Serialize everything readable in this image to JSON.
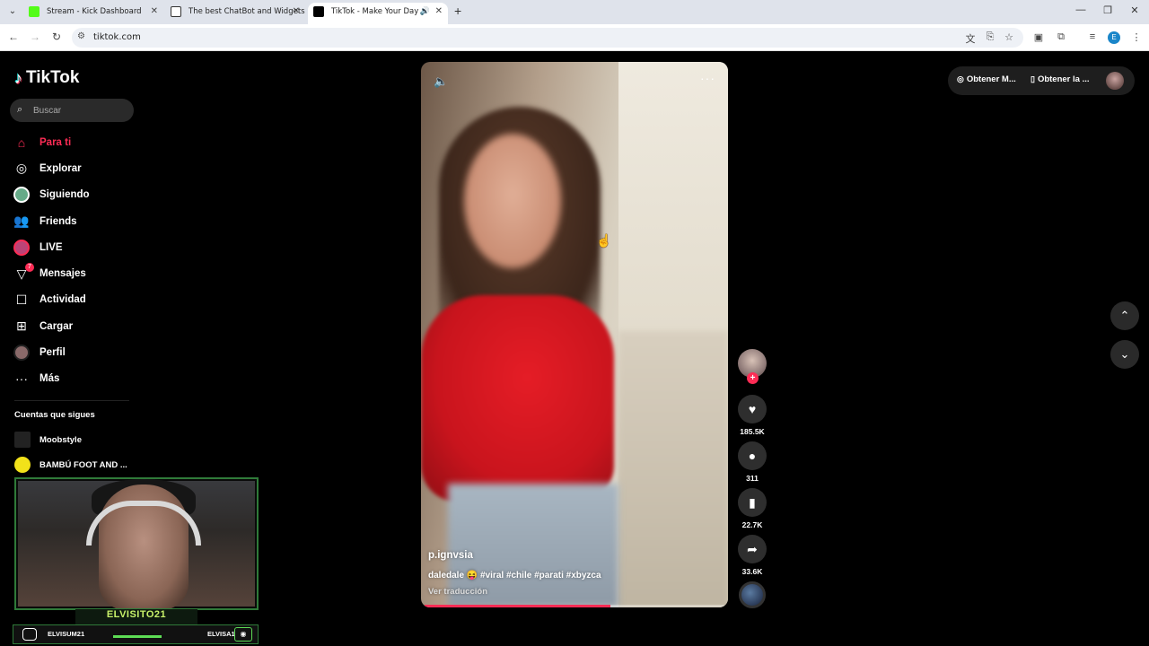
{
  "browser": {
    "tabs": [
      {
        "title": "Stream - Kick Dashboard",
        "favicon_color": "#53fc18"
      },
      {
        "title": "The best ChatBot and Widgets",
        "favicon_color": "#333333"
      },
      {
        "title": "TikTok - Make Your Day",
        "favicon_color": "#000000"
      }
    ],
    "url": "tiktok.com",
    "profile_letter": "E"
  },
  "tiktok": {
    "logo": "TikTok",
    "search_placeholder": "Buscar",
    "menu": [
      {
        "label": "Para ti",
        "icon": "home-icon"
      },
      {
        "label": "Explorar",
        "icon": "compass-icon"
      },
      {
        "label": "Siguiendo",
        "icon": "following-avatar-icon"
      },
      {
        "label": "Friends",
        "icon": "friends-icon"
      },
      {
        "label": "LIVE",
        "icon": "live-icon"
      },
      {
        "label": "Mensajes",
        "icon": "messages-icon",
        "badge": "7"
      },
      {
        "label": "Actividad",
        "icon": "activity-icon"
      },
      {
        "label": "Cargar",
        "icon": "upload-icon"
      },
      {
        "label": "Perfil",
        "icon": "profile-avatar-icon"
      },
      {
        "label": "Más",
        "icon": "more-icon"
      }
    ],
    "following_title": "Cuentas que sigues",
    "following": [
      {
        "name": "Moobstyle"
      },
      {
        "name": "BAMBÚ FOOT AND ..."
      }
    ],
    "top_right": {
      "coins": "Obtener M...",
      "app": "Obtener la ..."
    }
  },
  "video": {
    "username": "p.ignvsia",
    "description": "daledale 😝 #viral #chile #parati #xbyzca",
    "translate": "Ver traducción",
    "progress": 0.62,
    "likes": "185.5K",
    "comments": "311",
    "saves": "22.7K",
    "shares": "33.6K"
  },
  "webcam": {
    "name": "ELVISITO21",
    "instagram": "ELVISUM21",
    "discord": "ELVISA1"
  }
}
